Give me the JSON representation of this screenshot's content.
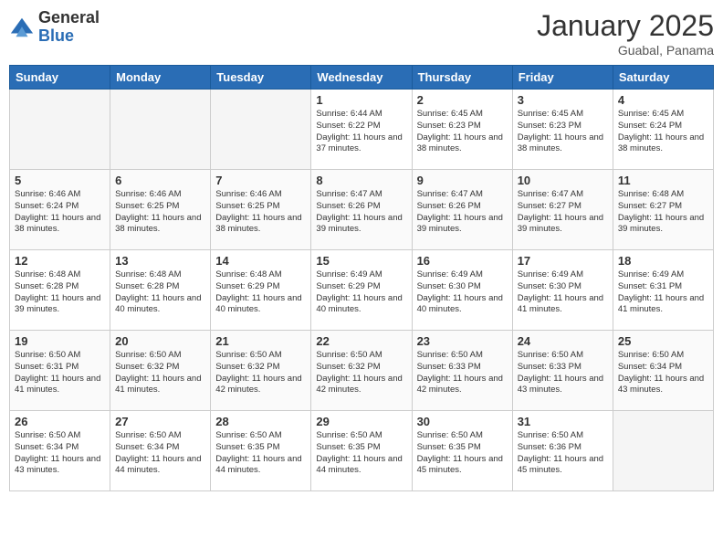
{
  "header": {
    "logo_general": "General",
    "logo_blue": "Blue",
    "month_year": "January 2025",
    "location": "Guabal, Panama"
  },
  "weekdays": [
    "Sunday",
    "Monday",
    "Tuesday",
    "Wednesday",
    "Thursday",
    "Friday",
    "Saturday"
  ],
  "weeks": [
    [
      {
        "day": "",
        "sunrise": "",
        "sunset": "",
        "daylight": ""
      },
      {
        "day": "",
        "sunrise": "",
        "sunset": "",
        "daylight": ""
      },
      {
        "day": "",
        "sunrise": "",
        "sunset": "",
        "daylight": ""
      },
      {
        "day": "1",
        "sunrise": "Sunrise: 6:44 AM",
        "sunset": "Sunset: 6:22 PM",
        "daylight": "Daylight: 11 hours and 37 minutes."
      },
      {
        "day": "2",
        "sunrise": "Sunrise: 6:45 AM",
        "sunset": "Sunset: 6:23 PM",
        "daylight": "Daylight: 11 hours and 38 minutes."
      },
      {
        "day": "3",
        "sunrise": "Sunrise: 6:45 AM",
        "sunset": "Sunset: 6:23 PM",
        "daylight": "Daylight: 11 hours and 38 minutes."
      },
      {
        "day": "4",
        "sunrise": "Sunrise: 6:45 AM",
        "sunset": "Sunset: 6:24 PM",
        "daylight": "Daylight: 11 hours and 38 minutes."
      }
    ],
    [
      {
        "day": "5",
        "sunrise": "Sunrise: 6:46 AM",
        "sunset": "Sunset: 6:24 PM",
        "daylight": "Daylight: 11 hours and 38 minutes."
      },
      {
        "day": "6",
        "sunrise": "Sunrise: 6:46 AM",
        "sunset": "Sunset: 6:25 PM",
        "daylight": "Daylight: 11 hours and 38 minutes."
      },
      {
        "day": "7",
        "sunrise": "Sunrise: 6:46 AM",
        "sunset": "Sunset: 6:25 PM",
        "daylight": "Daylight: 11 hours and 38 minutes."
      },
      {
        "day": "8",
        "sunrise": "Sunrise: 6:47 AM",
        "sunset": "Sunset: 6:26 PM",
        "daylight": "Daylight: 11 hours and 39 minutes."
      },
      {
        "day": "9",
        "sunrise": "Sunrise: 6:47 AM",
        "sunset": "Sunset: 6:26 PM",
        "daylight": "Daylight: 11 hours and 39 minutes."
      },
      {
        "day": "10",
        "sunrise": "Sunrise: 6:47 AM",
        "sunset": "Sunset: 6:27 PM",
        "daylight": "Daylight: 11 hours and 39 minutes."
      },
      {
        "day": "11",
        "sunrise": "Sunrise: 6:48 AM",
        "sunset": "Sunset: 6:27 PM",
        "daylight": "Daylight: 11 hours and 39 minutes."
      }
    ],
    [
      {
        "day": "12",
        "sunrise": "Sunrise: 6:48 AM",
        "sunset": "Sunset: 6:28 PM",
        "daylight": "Daylight: 11 hours and 39 minutes."
      },
      {
        "day": "13",
        "sunrise": "Sunrise: 6:48 AM",
        "sunset": "Sunset: 6:28 PM",
        "daylight": "Daylight: 11 hours and 40 minutes."
      },
      {
        "day": "14",
        "sunrise": "Sunrise: 6:48 AM",
        "sunset": "Sunset: 6:29 PM",
        "daylight": "Daylight: 11 hours and 40 minutes."
      },
      {
        "day": "15",
        "sunrise": "Sunrise: 6:49 AM",
        "sunset": "Sunset: 6:29 PM",
        "daylight": "Daylight: 11 hours and 40 minutes."
      },
      {
        "day": "16",
        "sunrise": "Sunrise: 6:49 AM",
        "sunset": "Sunset: 6:30 PM",
        "daylight": "Daylight: 11 hours and 40 minutes."
      },
      {
        "day": "17",
        "sunrise": "Sunrise: 6:49 AM",
        "sunset": "Sunset: 6:30 PM",
        "daylight": "Daylight: 11 hours and 41 minutes."
      },
      {
        "day": "18",
        "sunrise": "Sunrise: 6:49 AM",
        "sunset": "Sunset: 6:31 PM",
        "daylight": "Daylight: 11 hours and 41 minutes."
      }
    ],
    [
      {
        "day": "19",
        "sunrise": "Sunrise: 6:50 AM",
        "sunset": "Sunset: 6:31 PM",
        "daylight": "Daylight: 11 hours and 41 minutes."
      },
      {
        "day": "20",
        "sunrise": "Sunrise: 6:50 AM",
        "sunset": "Sunset: 6:32 PM",
        "daylight": "Daylight: 11 hours and 41 minutes."
      },
      {
        "day": "21",
        "sunrise": "Sunrise: 6:50 AM",
        "sunset": "Sunset: 6:32 PM",
        "daylight": "Daylight: 11 hours and 42 minutes."
      },
      {
        "day": "22",
        "sunrise": "Sunrise: 6:50 AM",
        "sunset": "Sunset: 6:32 PM",
        "daylight": "Daylight: 11 hours and 42 minutes."
      },
      {
        "day": "23",
        "sunrise": "Sunrise: 6:50 AM",
        "sunset": "Sunset: 6:33 PM",
        "daylight": "Daylight: 11 hours and 42 minutes."
      },
      {
        "day": "24",
        "sunrise": "Sunrise: 6:50 AM",
        "sunset": "Sunset: 6:33 PM",
        "daylight": "Daylight: 11 hours and 43 minutes."
      },
      {
        "day": "25",
        "sunrise": "Sunrise: 6:50 AM",
        "sunset": "Sunset: 6:34 PM",
        "daylight": "Daylight: 11 hours and 43 minutes."
      }
    ],
    [
      {
        "day": "26",
        "sunrise": "Sunrise: 6:50 AM",
        "sunset": "Sunset: 6:34 PM",
        "daylight": "Daylight: 11 hours and 43 minutes."
      },
      {
        "day": "27",
        "sunrise": "Sunrise: 6:50 AM",
        "sunset": "Sunset: 6:34 PM",
        "daylight": "Daylight: 11 hours and 44 minutes."
      },
      {
        "day": "28",
        "sunrise": "Sunrise: 6:50 AM",
        "sunset": "Sunset: 6:35 PM",
        "daylight": "Daylight: 11 hours and 44 minutes."
      },
      {
        "day": "29",
        "sunrise": "Sunrise: 6:50 AM",
        "sunset": "Sunset: 6:35 PM",
        "daylight": "Daylight: 11 hours and 44 minutes."
      },
      {
        "day": "30",
        "sunrise": "Sunrise: 6:50 AM",
        "sunset": "Sunset: 6:35 PM",
        "daylight": "Daylight: 11 hours and 45 minutes."
      },
      {
        "day": "31",
        "sunrise": "Sunrise: 6:50 AM",
        "sunset": "Sunset: 6:36 PM",
        "daylight": "Daylight: 11 hours and 45 minutes."
      },
      {
        "day": "",
        "sunrise": "",
        "sunset": "",
        "daylight": ""
      }
    ]
  ]
}
